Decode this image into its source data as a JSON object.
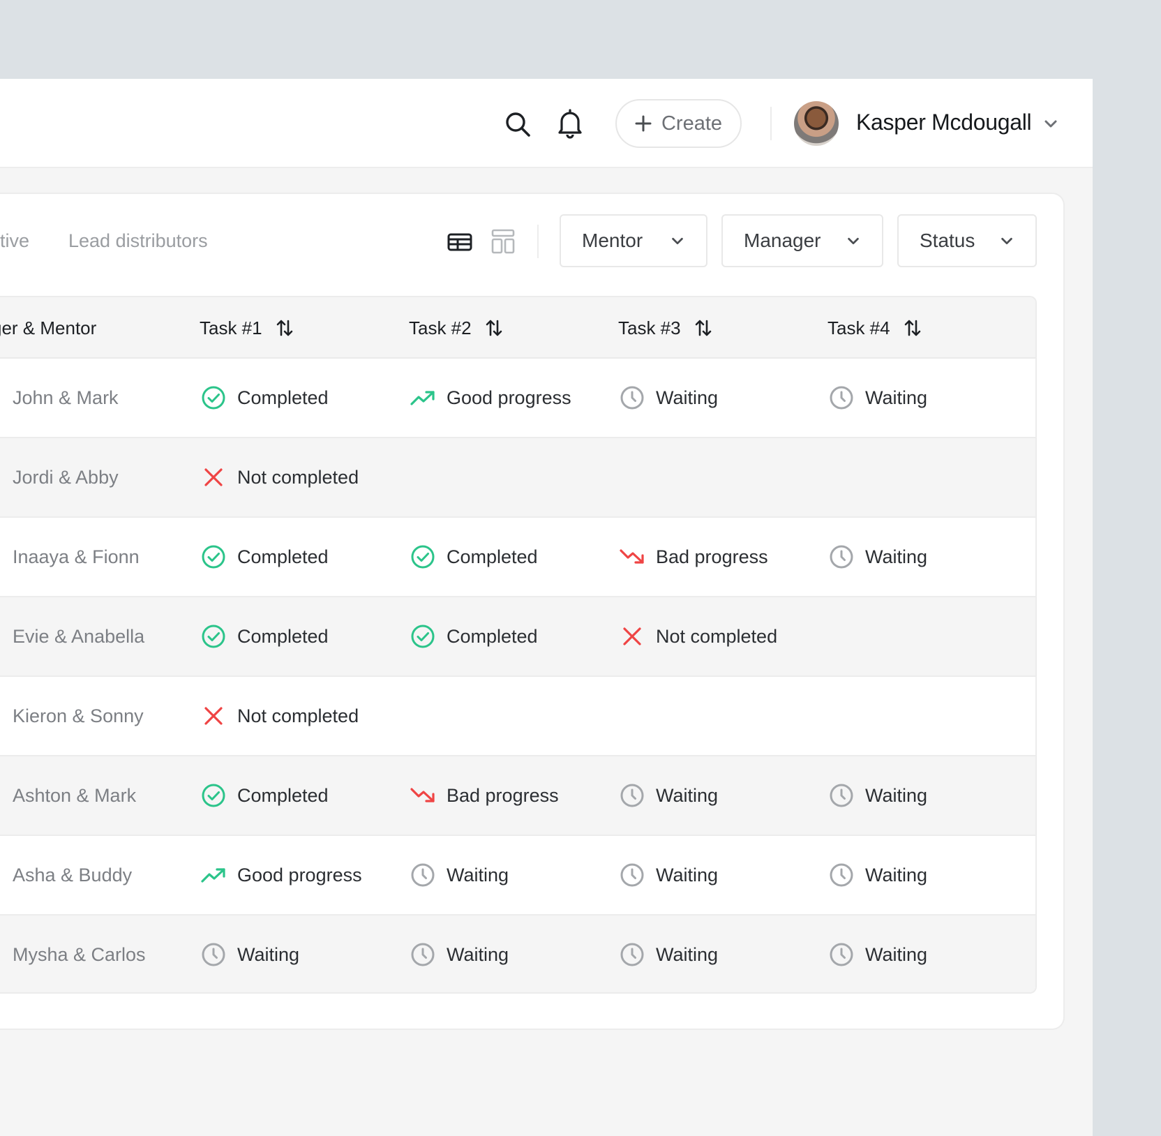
{
  "header": {
    "create_label": "Create",
    "user_name": "Kasper Mcdougall"
  },
  "tabs": [
    {
      "label": "tive"
    },
    {
      "label": "Lead distributors"
    }
  ],
  "filters": {
    "mentor": "Mentor",
    "manager": "Manager",
    "status": "Status"
  },
  "table": {
    "columns": [
      "ger & Mentor",
      "Task #1",
      "Task #2",
      "Task #3",
      "Task #4"
    ],
    "rows": [
      {
        "name": "John & Mark",
        "tasks": [
          "Completed",
          "Good progress",
          "Waiting",
          "Waiting"
        ]
      },
      {
        "name": "Jordi & Abby",
        "tasks": [
          "Not completed",
          "",
          "",
          ""
        ]
      },
      {
        "name": "Inaaya & Fionn",
        "tasks": [
          "Completed",
          "Completed",
          "Bad progress",
          "Waiting"
        ]
      },
      {
        "name": "Evie & Anabella",
        "tasks": [
          "Completed",
          "Completed",
          "Not completed",
          ""
        ]
      },
      {
        "name": "Kieron & Sonny",
        "tasks": [
          "Not completed",
          "",
          "",
          ""
        ]
      },
      {
        "name": "Ashton & Mark",
        "tasks": [
          "Completed",
          "Bad progress",
          "Waiting",
          "Waiting"
        ]
      },
      {
        "name": "Asha & Buddy",
        "tasks": [
          "Good progress",
          "Waiting",
          "Waiting",
          "Waiting"
        ]
      },
      {
        "name": "Mysha & Carlos",
        "tasks": [
          "Waiting",
          "Waiting",
          "Waiting",
          "Waiting"
        ]
      }
    ]
  },
  "status_icons": {
    "Completed": "check-circle-icon",
    "Good progress": "trend-up-icon",
    "Bad progress": "trend-down-icon",
    "Waiting": "clock-icon",
    "Not completed": "x-mark-icon"
  },
  "colors": {
    "success": "#2bc48a",
    "danger": "#ef4444",
    "muted": "#a4a7ab"
  }
}
